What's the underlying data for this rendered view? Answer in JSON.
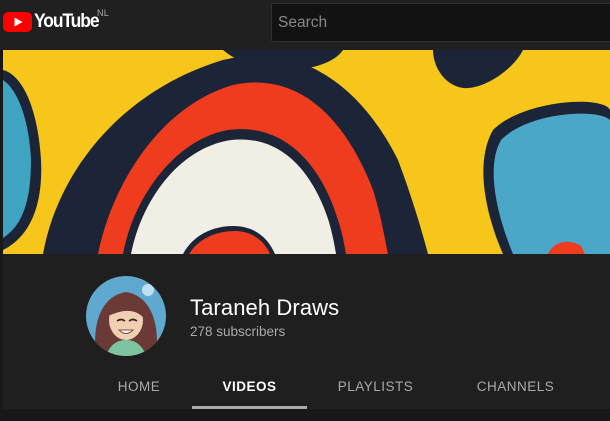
{
  "masthead": {
    "logo_text": "YouTube",
    "country_code": "NL",
    "search_placeholder": "Search"
  },
  "channel": {
    "name": "Taraneh Draws",
    "subscribers": "278 subscribers"
  },
  "tabs": [
    {
      "label": "HOME",
      "selected": false
    },
    {
      "label": "VIDEOS",
      "selected": true
    },
    {
      "label": "PLAYLISTS",
      "selected": false
    },
    {
      "label": "CHANNELS",
      "selected": false
    }
  ],
  "colors": {
    "brand_red": "#ff0000",
    "background": "#181818",
    "masthead": "#202020",
    "text_secondary": "#aaaaaa"
  }
}
